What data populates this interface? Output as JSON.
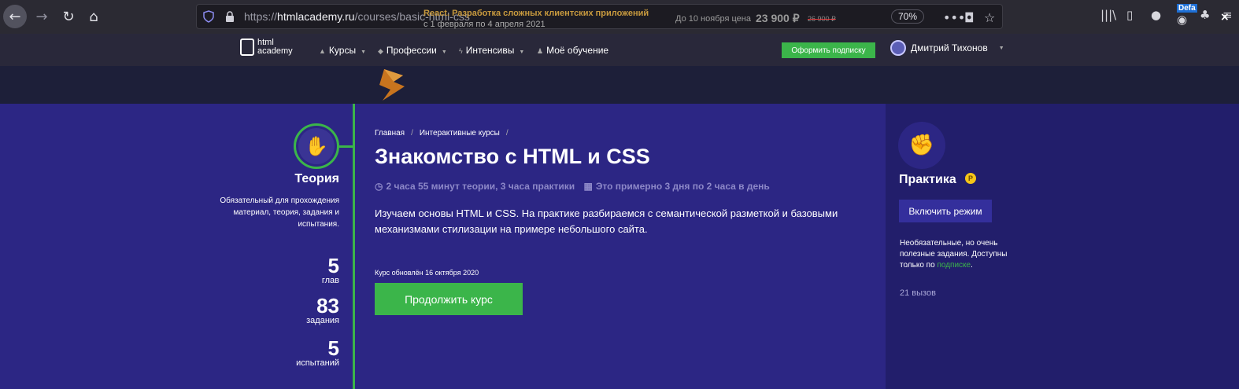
{
  "browser": {
    "url_prefix": "https://",
    "url_domain": "htmlacademy.ru",
    "url_path": "/courses/basic-html-css",
    "zoom": "70%",
    "badge": "Defa"
  },
  "header": {
    "logo_line1": "html",
    "logo_line2": "academy",
    "menu": [
      {
        "label": "Курсы"
      },
      {
        "label": "Профессии"
      },
      {
        "label": "Интенсивы"
      },
      {
        "label": "Моё обучение"
      }
    ],
    "subscribe_label": "Оформить подписку",
    "user_name": "Дмитрий Тихонов"
  },
  "promo": {
    "title": "React. Разработка сложных клиентских приложений",
    "dates": "с 1 февраля по 4 апреля 2021",
    "price_label": "До 10 ноября цена",
    "price": "23 900 ₽",
    "old_price": "26 900 ₽",
    "close": "×"
  },
  "theory": {
    "title": "Теория",
    "description": "Обязательный для прохождения материал, теория, задания и испытания.",
    "stats": [
      {
        "num": "5",
        "label": "глав"
      },
      {
        "num": "83",
        "label": "задания"
      },
      {
        "num": "5",
        "label": "испытаний"
      }
    ]
  },
  "course": {
    "breadcrumb": [
      "Главная",
      "Интерактивные курсы"
    ],
    "breadcrumb_sep": "/",
    "title": "Знакомство с HTML и CSS",
    "meta_duration": "2 часа 55 минут теории, 3 часа практики",
    "meta_days": "Это примерно 3 дня по 2 часа в день",
    "description": "Изучаем основы HTML и CSS. На практике разбираемся с семантической разметкой и базовыми механизмами стилизации на примере небольшого сайта.",
    "updated": "Курс обновлён 16 октября 2020",
    "continue_label": "Продолжить курс"
  },
  "practice": {
    "title": "Практика",
    "coin": "P",
    "enable_label": "Включить режим",
    "desc_before": "Необязательные, но очень полезные задания. Доступны только по ",
    "desc_link": "подписке",
    "desc_after": ".",
    "calls": "21 вызов"
  },
  "colors": {
    "accent": "#3bb54a",
    "main_bg": "#2c2684",
    "side_bg": "#221e6b"
  }
}
